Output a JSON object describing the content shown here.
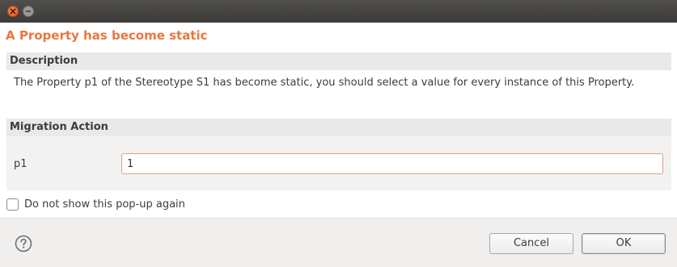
{
  "window": {
    "close_icon": "close-icon",
    "minimize_icon": "minimize-icon"
  },
  "dialog": {
    "title": "A Property has become static",
    "accent_color": "#e8773f"
  },
  "description": {
    "header": "Description",
    "text": "The Property p1 of the Stereotype S1 has become static, you should select a value for every instance of this Property."
  },
  "migration": {
    "header": "Migration Action",
    "field_label": "p1",
    "field_value": "1"
  },
  "options": {
    "dont_show_label": "Do not show this pop-up again",
    "dont_show_checked": false
  },
  "footer": {
    "help_icon": "help-icon",
    "cancel_label": "Cancel",
    "ok_label": "OK"
  }
}
